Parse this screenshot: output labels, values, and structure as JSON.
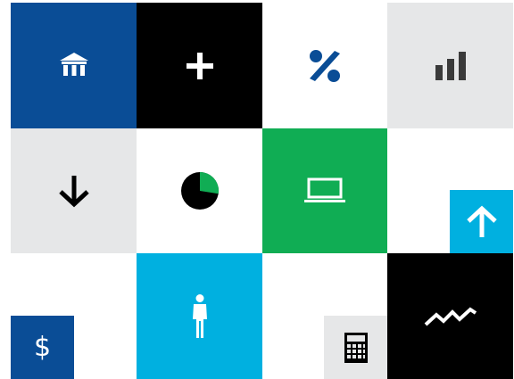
{
  "colors": {
    "navy": "#0a4d96",
    "black": "#000000",
    "white": "#ffffff",
    "light_gray": "#e6e7e8",
    "green": "#10ad54",
    "cyan": "#00b0e0"
  },
  "tiles": [
    {
      "icon": "bank-icon",
      "background": "#0a4d96",
      "icon_color": "#ffffff"
    },
    {
      "icon": "plus-icon",
      "background": "#000000",
      "icon_color": "#ffffff"
    },
    {
      "icon": "percent-icon",
      "background": "#ffffff",
      "icon_color": "#0a4d96"
    },
    {
      "icon": "bar-chart-icon",
      "background": "#e6e7e8",
      "icon_color": "#3a3a3a"
    },
    {
      "icon": "arrow-down-icon",
      "background": "#e6e7e8",
      "icon_color": "#000000"
    },
    {
      "icon": "pie-chart-icon",
      "background": "#ffffff",
      "icon_color": "#000000"
    },
    {
      "icon": "laptop-icon",
      "background": "#10ad54",
      "icon_color": "#ffffff"
    },
    {
      "icon": "arrow-up-icon",
      "background": "#00b0e0",
      "icon_color": "#ffffff"
    },
    {
      "icon": "person-icon",
      "background": "#00b0e0",
      "icon_color": "#ffffff"
    },
    {
      "icon": "trend-line-icon",
      "background": "#000000",
      "icon_color": "#ffffff"
    },
    {
      "icon": "dollar-icon",
      "background": "#0a4d96",
      "icon_color": "#ffffff"
    },
    {
      "icon": "calculator-icon",
      "background": "#e6e7e8",
      "icon_color": "#000000"
    }
  ],
  "dollar_tile": {
    "symbol": "$"
  },
  "pie": {
    "highlight_fraction": 0.28,
    "highlight_color": "#10ad54"
  }
}
